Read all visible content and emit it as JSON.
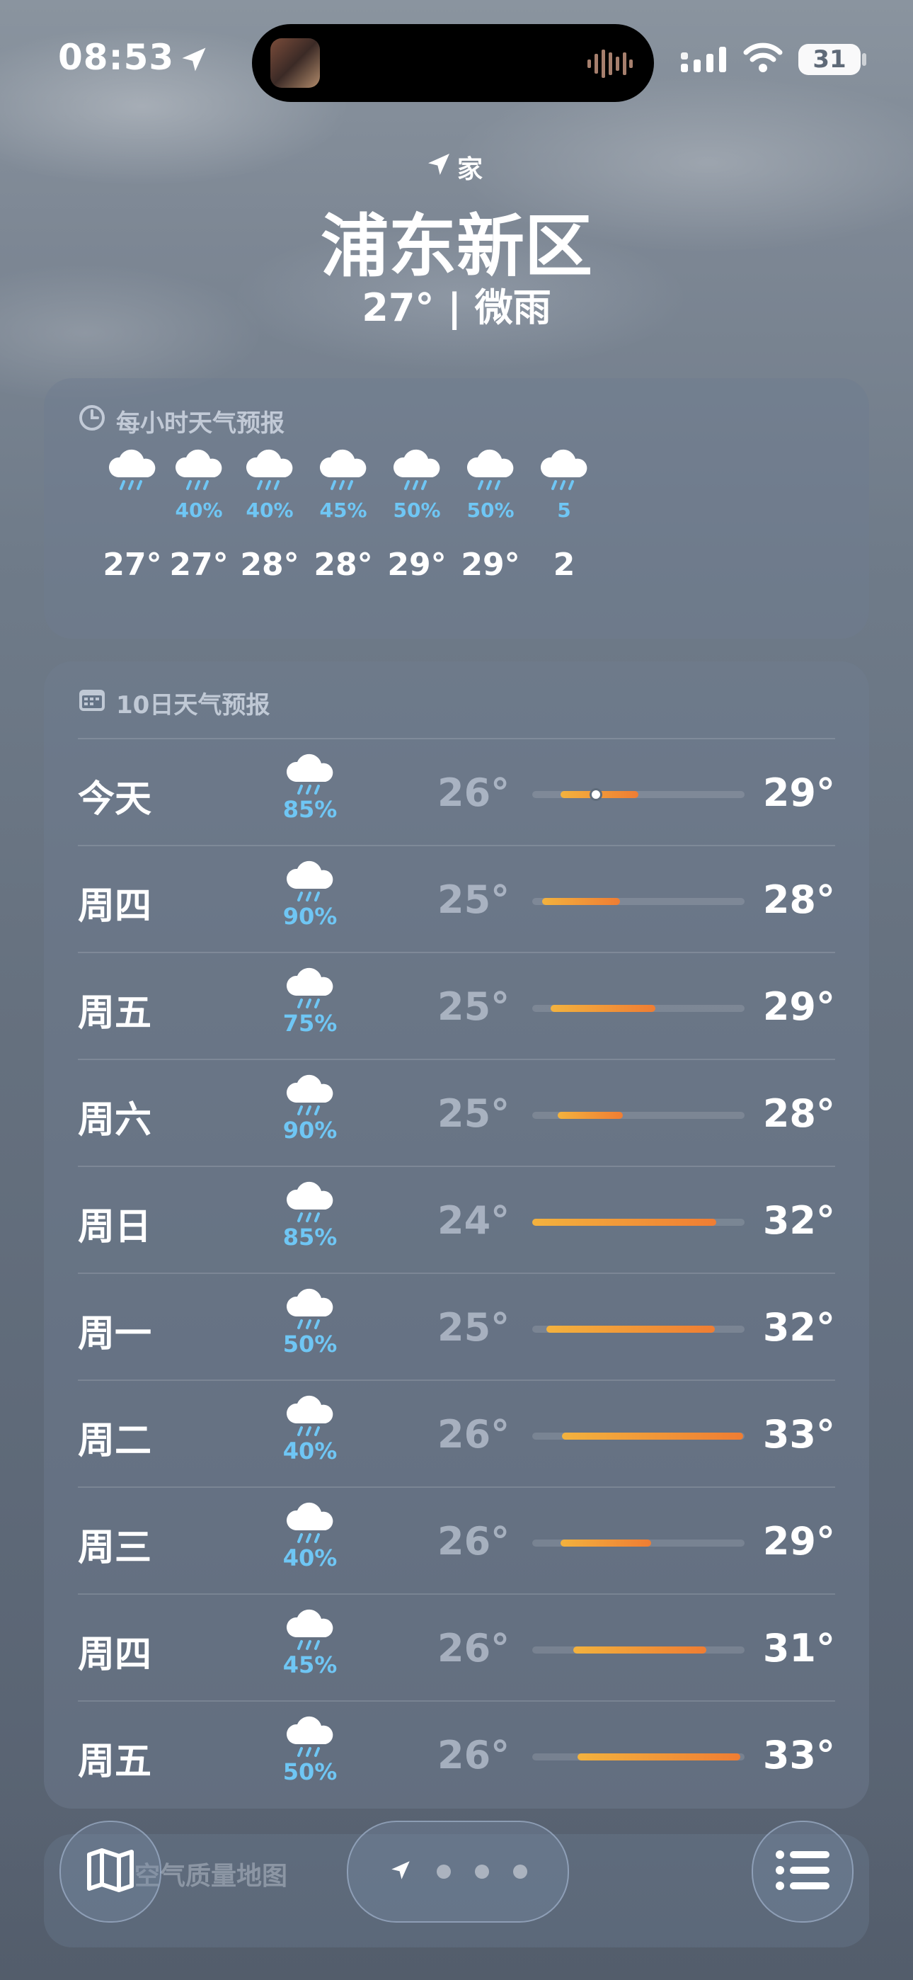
{
  "status": {
    "time": "08:53",
    "battery": "31"
  },
  "header": {
    "home_label": "家",
    "city": "浦东新区",
    "summary": "27° | 微雨"
  },
  "hourly": {
    "title": "每小时天气预报",
    "items": [
      {
        "pct": "",
        "temp": "27°"
      },
      {
        "pct": "40%",
        "temp": "27°"
      },
      {
        "pct": "40%",
        "temp": "28°"
      },
      {
        "pct": "45%",
        "temp": "28°"
      },
      {
        "pct": "50%",
        "temp": "29°"
      },
      {
        "pct": "50%",
        "temp": "29°"
      },
      {
        "pct": "5",
        "temp": "2"
      }
    ]
  },
  "daily": {
    "title": "10日天气预报",
    "rows": [
      {
        "day": "今天",
        "pct": "85%",
        "low": "26°",
        "high": "29°"
      },
      {
        "day": "周四",
        "pct": "90%",
        "low": "25°",
        "high": "28°"
      },
      {
        "day": "周五",
        "pct": "75%",
        "low": "25°",
        "high": "29°"
      },
      {
        "day": "周六",
        "pct": "90%",
        "low": "25°",
        "high": "28°"
      },
      {
        "day": "周日",
        "pct": "85%",
        "low": "24°",
        "high": "32°"
      },
      {
        "day": "周一",
        "pct": "50%",
        "low": "25°",
        "high": "32°"
      },
      {
        "day": "周二",
        "pct": "40%",
        "low": "26°",
        "high": "33°"
      },
      {
        "day": "周三",
        "pct": "40%",
        "low": "26°",
        "high": "29°"
      },
      {
        "day": "周四",
        "pct": "45%",
        "low": "26°",
        "high": "31°"
      },
      {
        "day": "周五",
        "pct": "50%",
        "low": "26°",
        "high": "33°"
      }
    ]
  },
  "air_quality": {
    "label": "空气质量地图"
  },
  "colors": {
    "accent_rain": "#6fc6f4",
    "temp_bar_start": "#f3b23e",
    "temp_bar_end": "#ef7d33"
  }
}
